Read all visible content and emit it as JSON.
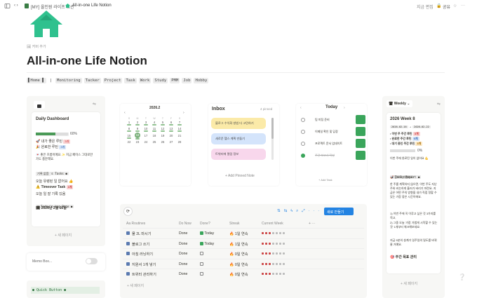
{
  "topbar": {
    "breadcrumb_workspace": "[MY] 올인원 라이프 노션",
    "breadcrumb_sep": "/",
    "breadcrumb_page": "All-in-one Life Notion",
    "edit_label": "지금 편집",
    "share_label": "공유"
  },
  "page": {
    "add_cover": "커버 추가",
    "title": "All-in-one Life Notion",
    "nav": [
      "▌Home ▌",
      "|",
      "Monitoring",
      "Tacker",
      "Project",
      "Task",
      "Work",
      "Study",
      "PMM",
      "Job",
      "Hobby"
    ]
  },
  "daily": {
    "title": "Daily Dashboard",
    "habit_tag": "● Habit Tracker ●",
    "habit_percent": "60%",
    "habit_progress": 0.6,
    "line1": "🚀 내가 좋은 루틴",
    "line1_tag": "3개",
    "line2": "🎉 완료한 루틴",
    "line2_tag": "3개",
    "line3": "💌 좋은 흐름이에요 ✨ 지금 페이스 그대로만",
    "line3b": "가도 충분해요.",
    "tasks_tag": "● Today's Tasks ●",
    "tasks_sub": "기록 없음",
    "tasks_line": "오늘 유령된 일 없어요 👍",
    "timeover": "⚠️ Timeover Task",
    "timeover_tag": "1개",
    "timeover_sub": "오늘 일 잘 기록 있음",
    "log_tag": "● Today's Log Page ●",
    "log_date": "🗓 2026년 2월 16일",
    "new_page": "+ 새 페이지"
  },
  "calendar": {
    "title": "2026.2",
    "weekdays": [
      "S",
      "M",
      "T",
      "W",
      "T",
      "F",
      "S"
    ],
    "weeks": [
      [
        "1",
        "2",
        "3",
        "4",
        "5",
        "6",
        "7"
      ],
      [
        "8",
        "9",
        "10",
        "11",
        "12",
        "13",
        "14"
      ],
      [
        "15",
        "16",
        "17",
        "18",
        "19",
        "20",
        "21"
      ],
      [
        "22",
        "23",
        "24",
        "25",
        "26",
        "27",
        "28"
      ]
    ],
    "today": "16"
  },
  "inbox": {
    "title": "Inbox",
    "pinned": "4 pinned",
    "notes": [
      "블로그 수익화 방법 더 고민하기",
      "새로운 헬스 계획 만들기",
      "트위터에 멀림 정보"
    ],
    "add_note": "+ Add Pinned Note"
  },
  "today": {
    "title": "Today",
    "items": [
      "팀 미팅 준비",
      "이메일 확인 및 답장",
      "프로젝트 문서 업데이트",
      "주간 보고서 작성"
    ],
    "add": "+ Add Task"
  },
  "memo": {
    "label": "Memo Box...",
    "quick_button": "● Quick Button ●"
  },
  "routines": {
    "new_button": "새로 만들기",
    "columns": [
      "Aa Routines",
      "Do Now",
      "Done?",
      "Streak",
      "Current Week"
    ],
    "rows": [
      {
        "name": "물 2L 마시기",
        "do": "Done",
        "done": "Today",
        "checked": true,
        "streak": "🔥 1일 연속"
      },
      {
        "name": "블로그 쓰기",
        "do": "Done",
        "done": "Today",
        "checked": true,
        "streak": "🔥 1일 연속"
      },
      {
        "name": "아침 러닝하기",
        "do": "Done",
        "done": "",
        "checked": false,
        "streak": "🔥 0일 연속"
      },
      {
        "name": "지원서 1개 넣기",
        "do": "Done",
        "done": "",
        "checked": false,
        "streak": "🔥 0일 연속"
      },
      {
        "name": "트위터 관리하기",
        "do": "Done",
        "done": "",
        "checked": false,
        "streak": "🔥 0일 연속"
      }
    ],
    "new_page": "+ 새 페이지"
  },
  "weekly": {
    "title": "Weekly",
    "week": "2026 Week 8",
    "range_a": "2026-02-16",
    "range_arrow": "→",
    "range_b": "2026-02-22",
    "l1": "• 이번 주 주간 루틴",
    "l1_tag": "3개",
    "l2": "• 완료한 주간 루틴",
    "l2_tag": "0개",
    "l3": "• 대기 중인 주간 루틴",
    "l3_tag": "3개",
    "percent": "0%",
    "p1": "이번 주에 완료된 일이 없어요 💪",
    "report_tag": "● Today Report ●",
    "p2": "🚀 힘으로 마쳤어요!",
    "p3": "한 주를 계획하지 않으면, 이번 주도 지난주와 비슷하게 흘러가 버리기 마련요. 지금은 어떤 주의 방향을 내가 직접 정할 수 있는 가장 좋은 시간이에요.",
    "p4": "1) 이번 주에 꼭 이루고 싶은 것 3가지를 적고,",
    "p5": "2) 그중 오늘 '가장 가볍게 시작할 수 있는 것' 1개부터 체크해보세요.",
    "p6": "지금 5분의 설계가 일주일의 밀도를 바꿔줄 거예요.",
    "goal": "🎯 주간 목표 관리",
    "new_page": "+ 새 페이지"
  },
  "colors": {
    "accent": "#2383e2",
    "green": "#3aa55b",
    "note_yellow": "#fbeaa8",
    "note_blue": "#d4e4fb",
    "note_pink": "#f8d7ec"
  }
}
